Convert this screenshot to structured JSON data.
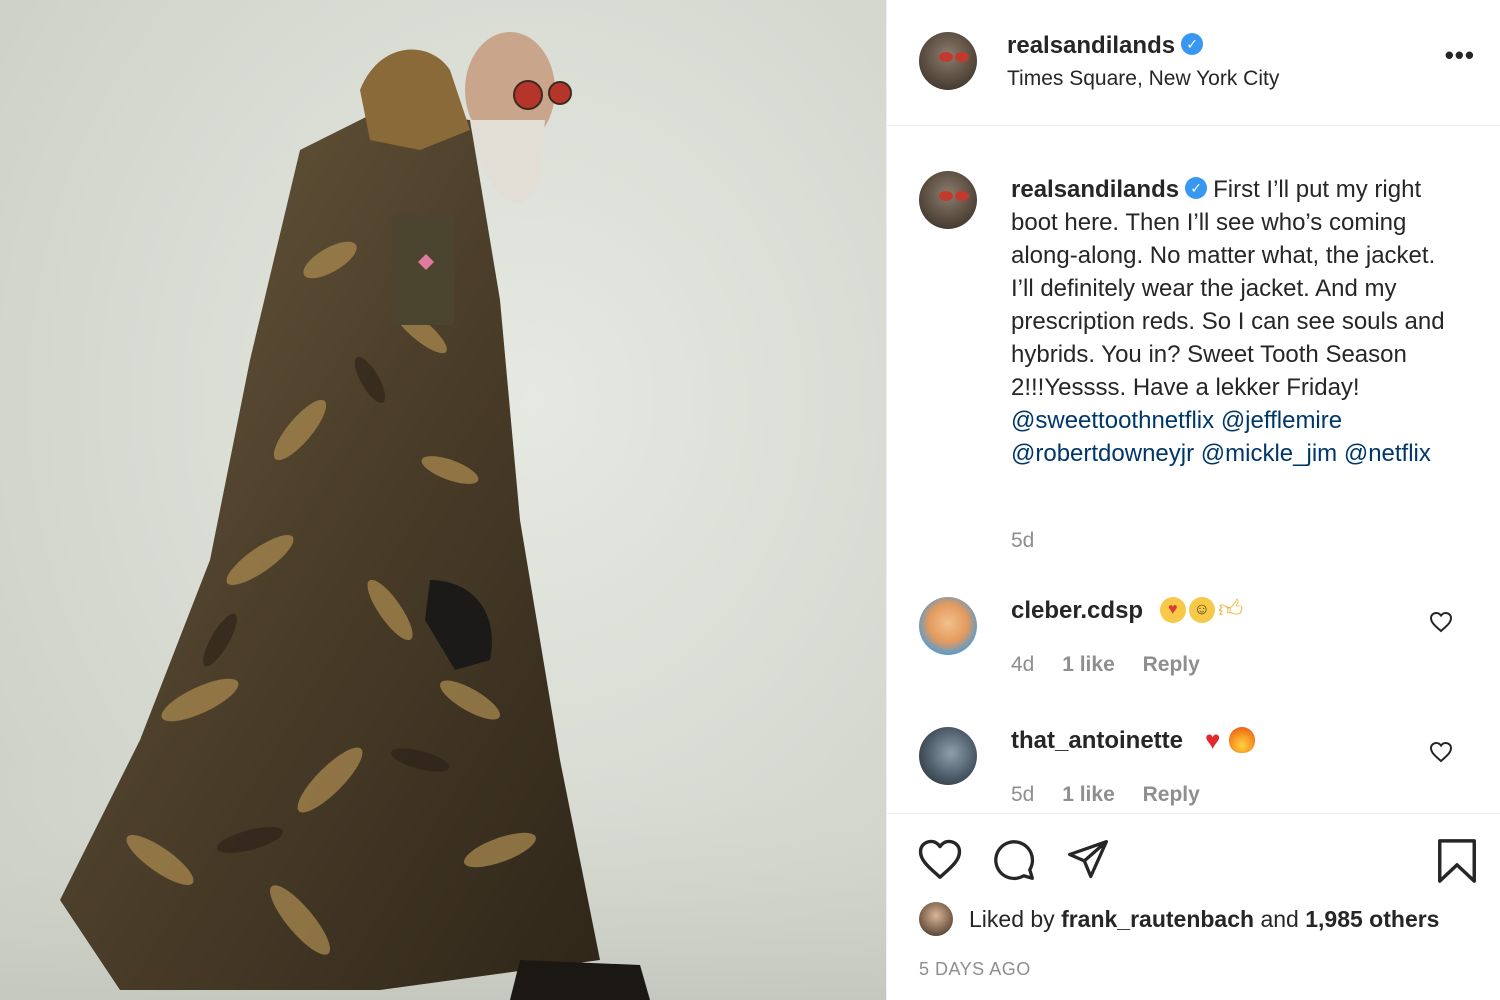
{
  "post": {
    "username": "realsandilands",
    "location": "Times Square, New York City",
    "more_label": "•••"
  },
  "caption": {
    "username": "realsandilands",
    "text": "First I’ll put my right boot here. Then I’ll see who’s coming along-along. No matter what, the jacket. I’ll definitely wear the jacket. And my prescription reds. So I can see souls and hybrids. You in? Sweet Tooth Season 2!!!Yessss. Have a lekker Friday!",
    "mentions": [
      "@sweettoothnetflix",
      "@jefflemire",
      "@robertdowneyjr",
      "@mickle_jim",
      "@netflix"
    ],
    "time_ago": "5d"
  },
  "comments": [
    {
      "username": "cleber.cdsp",
      "emojis": [
        "heart-eyes-emoji",
        "grin-emoji",
        "thumbs-up-emoji"
      ],
      "time": "4d",
      "likes": "1 like",
      "reply": "Reply"
    },
    {
      "username": "that_antoinette",
      "emojis": [
        "red-heart-emoji",
        "fire-emoji"
      ],
      "time": "5d",
      "likes": "1 like",
      "reply": "Reply"
    }
  ],
  "footer": {
    "liked_by_prefix": "Liked by",
    "liked_by_user": "frank_rautenbach",
    "liked_by_and": "and",
    "liked_by_others": "1,985 others",
    "date": "5 DAYS AGO"
  },
  "icons": [
    "heart-icon",
    "comment-icon",
    "share-icon",
    "bookmark-icon",
    "verified-badge-icon"
  ],
  "colors": {
    "link": "#00376b",
    "verified": "#3897f0",
    "muted": "#8e8e8e",
    "text": "#262626"
  }
}
